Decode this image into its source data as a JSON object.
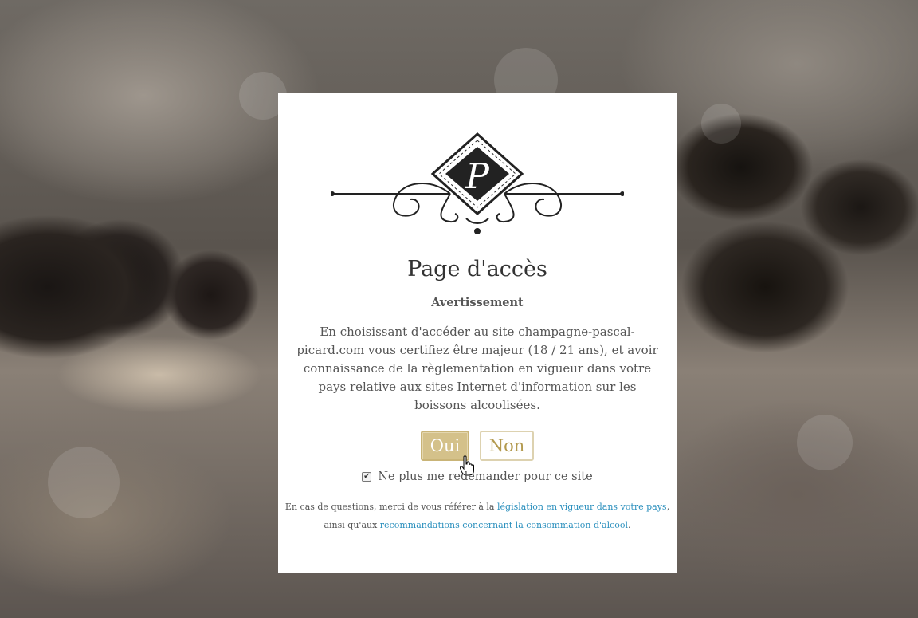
{
  "modal": {
    "title": "Page d'accès",
    "subtitle": "Avertissement",
    "paragraph": "En choisissant d'accéder au site champagne-pascal-picard.com vous certifiez être majeur (18 / 21 ans), et avoir connaissance de la règlementation en vigueur dans votre pays relative aux sites Internet d'information sur les boissons alcoolisées.",
    "buttons": {
      "yes_label": "Oui",
      "no_label": "Non"
    },
    "remember": {
      "label": "Ne plus me redemander pour ce site",
      "checked": true
    },
    "footer": {
      "line1_prefix": "En cas de questions, merci de vous référer à la ",
      "line1_link": "législation en vigueur dans votre pays",
      "line1_suffix": ",",
      "line2_prefix": "ainsi qu'aux ",
      "line2_link": "recommandations concernant la consommation d'alcool",
      "line2_suffix": "."
    }
  },
  "logo": {
    "monogram": "P",
    "icon": "pascal-picard-logo-ornament"
  },
  "colors": {
    "yes_button_bg": "#d4c18a",
    "no_button_text": "#b39a4f",
    "link": "#2a8fbd",
    "text": "#555555"
  }
}
